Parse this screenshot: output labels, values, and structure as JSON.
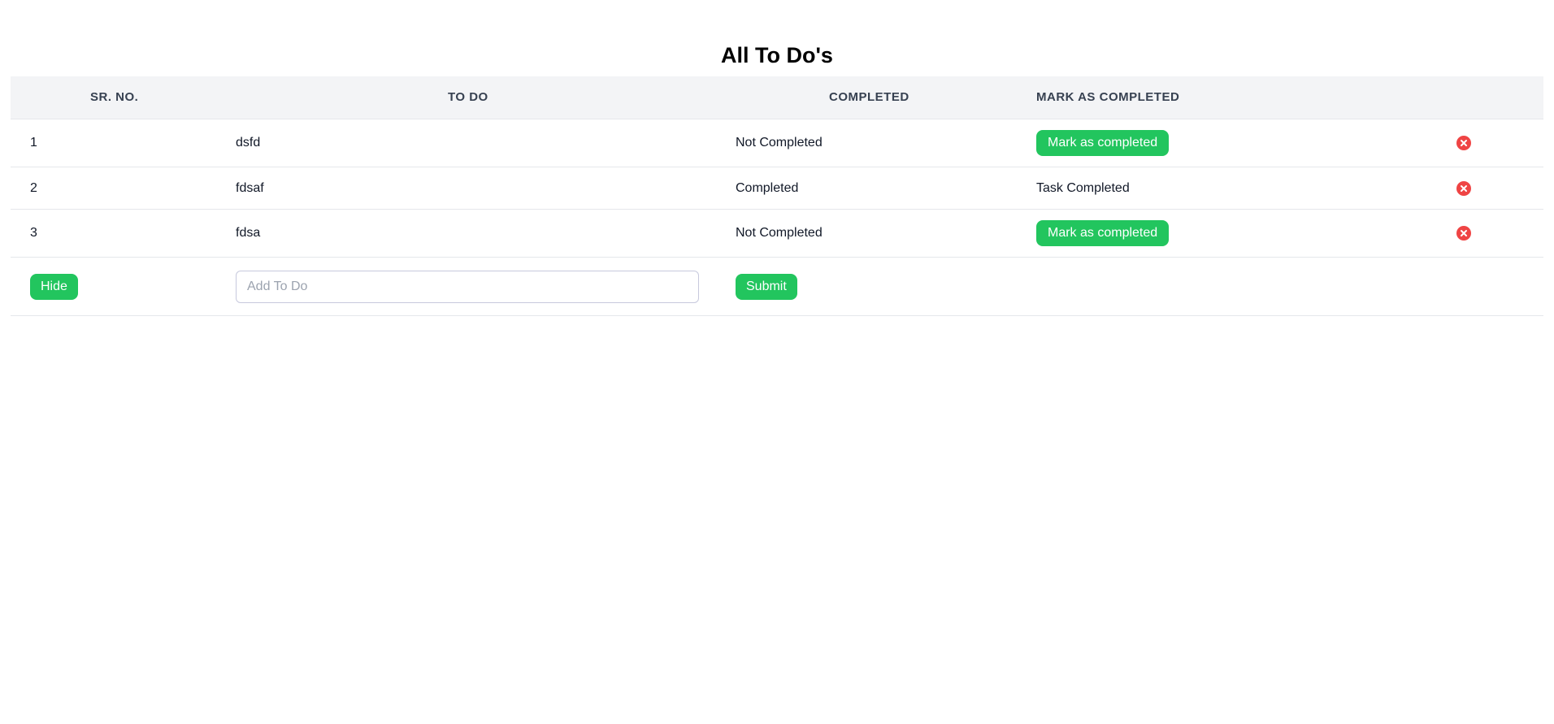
{
  "page": {
    "title": "All To Do's"
  },
  "table": {
    "headers": {
      "sr_no": "SR. NO.",
      "todo": "TO DO",
      "completed": "COMPLETED",
      "mark": "MARK AS COMPLETED"
    },
    "rows": [
      {
        "sr": "1",
        "todo": "dsfd",
        "status": "Not Completed",
        "action": "Mark as completed",
        "action_type": "button"
      },
      {
        "sr": "2",
        "todo": "fdsaf",
        "status": "Completed",
        "action": "Task Completed",
        "action_type": "text"
      },
      {
        "sr": "3",
        "todo": "fdsa",
        "status": "Not Completed",
        "action": "Mark as completed",
        "action_type": "button"
      }
    ]
  },
  "form": {
    "hide_label": "Hide",
    "input_value": "",
    "input_placeholder": "Add To Do",
    "submit_label": "Submit"
  },
  "colors": {
    "accent": "#22c55e",
    "delete": "#ef4444",
    "header_bg": "#f3f4f6"
  },
  "icons": {
    "delete": "close-circle-icon"
  }
}
